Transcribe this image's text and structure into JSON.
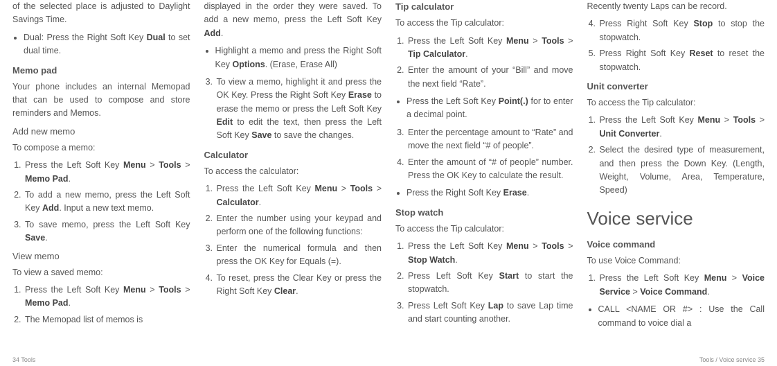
{
  "col1": {
    "frag1": "of the selected place is adjusted to Daylight Savings Time.",
    "bullet_dual": "Dual: Press the Right Soft Key <b>Dual</b> to set dual time.",
    "memo_pad_h": "Memo pad",
    "memo_pad_p": "Your phone includes an internal Memopad that can be used to compose and store reminders and Memos.",
    "add_memo_h": "Add new memo",
    "add_memo_intro": "To compose a memo:",
    "add_memo_1": "Press the Left Soft Key <b>Menu</b> > <b>Tools</b> > <b>Memo Pad</b>.",
    "add_memo_2": "To add a new memo, press the Left Soft Key <b>Add</b>. Input a new text memo.",
    "add_memo_3": "To save memo, press the Left Soft Key <b>Save</b>.",
    "view_memo_h": "View memo",
    "view_memo_intro": "To view a saved memo:",
    "view_memo_1": "Press the Left Soft Key <b>Menu</b> > <b>Tools</b> > <b>Memo Pad</b>.",
    "view_memo_2": "The Memopad list of memos is"
  },
  "col2": {
    "frag1": "displayed in the order they were saved. To add a new memo, press the Left Soft Key <b>Add</b>.",
    "bullet_opt": "Highlight a memo and press the Right Soft Key <b>Options</b>. (Erase, Erase All)",
    "item3": "To view a memo, highlight it and press the OK Key. Press the Right Soft Key <b>Erase</b> to erase the memo or press the Left Soft Key <b>Edit</b> to edit the text, then press the Left Soft Key <b>Save</b> to save the changes.",
    "calc_h": "Calculator",
    "calc_intro": "To access the calculator:",
    "calc_1": "Press the Left Soft Key <b>Menu</b> > <b>Tools</b> > <b>Calculator</b>.",
    "calc_2": "Enter the number using your keypad and perform one of the following functions:",
    "calc_3": "Enter the numerical formula and then press the OK Key for Equals (=).",
    "calc_4": "To reset, press the Clear Key or press the Right Soft Key <b>Clear</b>."
  },
  "col3": {
    "tip_h": "Tip calculator",
    "tip_intro": "To access the Tip calculator:",
    "tip_1": "Press the Left Soft Key <b>Menu</b> > <b>Tools</b> > <b>Tip Calculator</b>.",
    "tip_2": "Enter the amount of your “Bill” and move the next field “Rate”.",
    "tip_bullet": "Press the Left Soft Key <b>Point(.)</b> for to enter a decimal point.",
    "tip_3": "Enter the percentage amount to “Rate” and move the next field “# of people”.",
    "tip_4": "Enter the amount of “# of people” number. Press the OK Key to calculate the result.",
    "tip_bullet2": "Press the Right Soft Key <b>Erase</b>.",
    "stop_h": "Stop watch",
    "stop_intro": "To access the Tip calculator:",
    "stop_1": "Press the Left Soft Key <b>Menu</b> > <b>Tools</b> > <b>Stop Watch</b>.",
    "stop_2": "Press Left Soft Key <b>Start</b> to start the stopwatch.",
    "stop_3": "Press Left Soft Key <b>Lap</b> to save Lap time and start counting another."
  },
  "col4": {
    "frag1": "Recently twenty Laps can be record.",
    "stop_4": "Press Right Soft Key <b>Stop</b> to stop the stopwatch.",
    "stop_5": "Press Right Soft Key <b>Reset</b> to reset the stopwatch.",
    "unit_h": "Unit converter",
    "unit_intro": "To access the Tip calculator:",
    "unit_1": "Press the Left Soft Key <b>Menu</b> > <b>Tools</b> > <b>Unit Converter</b>.",
    "unit_2": "Select the desired type of measurement, and then press the Down Key. (Length, Weight, Volume, Area, Temperature, Speed)",
    "voice_h": "Voice service",
    "vc_h": "Voice command",
    "vc_intro": "To use Voice Command:",
    "vc_1": "Press the Left Soft Key <b>Menu</b> > <b>Voice Service</b> > <b>Voice Command</b>.",
    "vc_bullet": "CALL &lt;NAME OR #&gt; : Use the Call command to voice dial a"
  },
  "footer": {
    "left_num": "34",
    "left_text": "Tools",
    "right_text": "Tools / Voice service",
    "right_num": "35"
  }
}
